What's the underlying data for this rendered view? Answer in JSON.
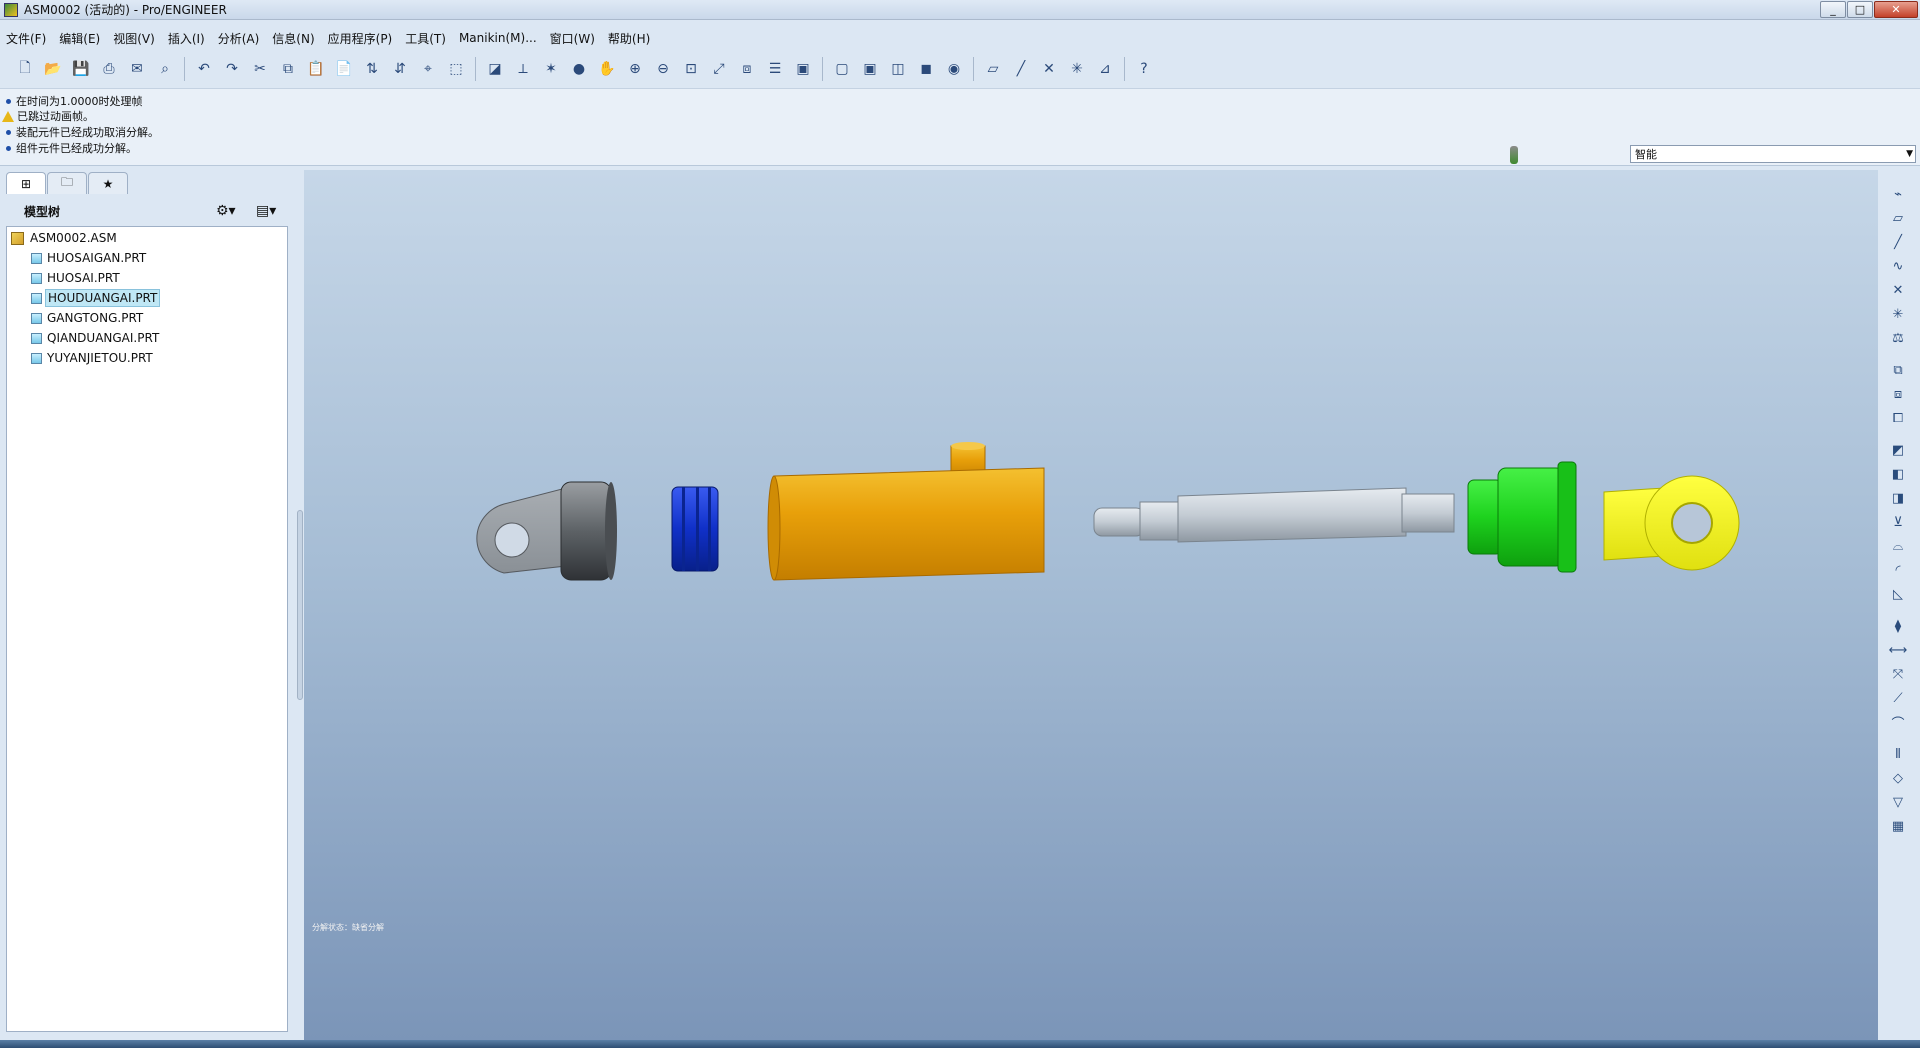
{
  "window": {
    "title": "ASM0002 (活动的) - Pro/ENGINEER",
    "min": "_",
    "max": "□",
    "close": "✕"
  },
  "menu": [
    "文件(F)",
    "编辑(E)",
    "视图(V)",
    "插入(I)",
    "分析(A)",
    "信息(N)",
    "应用程序(P)",
    "工具(T)",
    "Manikin(M)...",
    "窗口(W)",
    "帮助(H)"
  ],
  "messages": [
    {
      "type": "info",
      "text": "在时间为1.0000时处理帧"
    },
    {
      "type": "warning",
      "text": "已跳过动画帧。"
    },
    {
      "type": "info",
      "text": "装配元件已经成功取消分解。"
    },
    {
      "type": "info",
      "text": "组件元件已经成功分解。"
    }
  ],
  "filter": {
    "value": "智能"
  },
  "model_tree": {
    "header": "模型树",
    "root": "ASM0002.ASM",
    "items": [
      "HUOSAIGAN.PRT",
      "HUOSAI.PRT",
      "HOUDUANGAI.PRT",
      "GANGTONG.PRT",
      "QIANDUANGAI.PRT",
      "YUYANJIETOU.PRT"
    ],
    "selected": "HOUDUANGAI.PRT"
  },
  "viewport": {
    "status_text": "分解状态：缺省分解"
  },
  "colors": {
    "housing": "#e8a00a",
    "piston": "#1438c8",
    "front_cap": "#1ee01e",
    "rod_end": "#f2f21a",
    "rod": "#c7ced6",
    "clevis": "#9ea3a8"
  }
}
